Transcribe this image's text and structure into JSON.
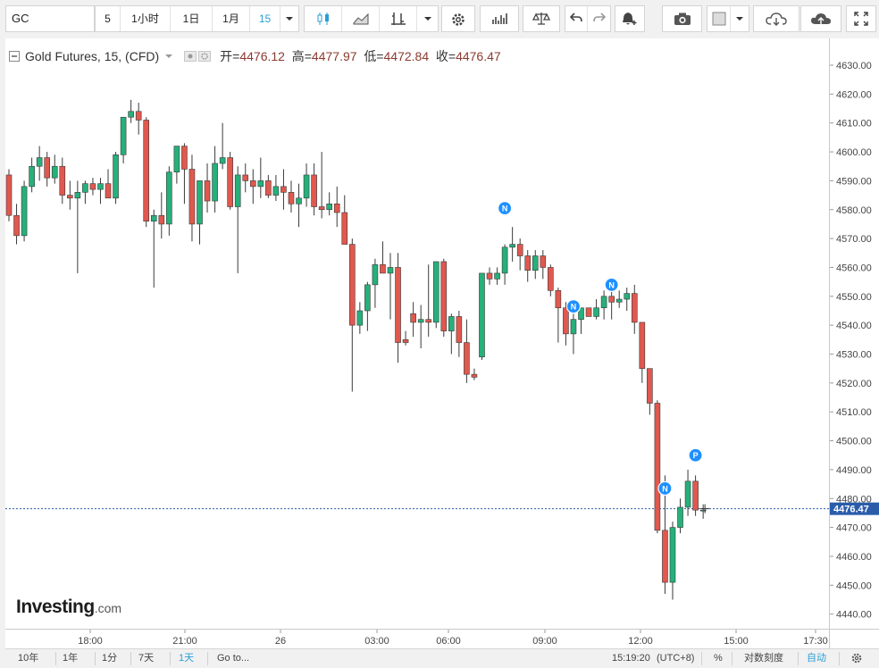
{
  "toolbar": {
    "symbol": "GC",
    "intervals": [
      "5",
      "1小时",
      "1日",
      "1月",
      "15"
    ],
    "active_interval": "15"
  },
  "legend": {
    "title": "Gold Futures, 15, (CFD)",
    "open_label": "开=",
    "open": "4476.12",
    "high_label": "高=",
    "high": "4477.97",
    "low_label": "低=",
    "low": "4472.84",
    "close_label": "收=",
    "close": "4476.47"
  },
  "watermark": {
    "brand": "Investing",
    "suffix": ".com"
  },
  "bottom_bar": {
    "ranges": [
      "10年",
      "1年",
      "1分",
      "7天",
      "1天"
    ],
    "active_range": "1天",
    "goto": "Go to...",
    "clock": "15:19:20",
    "timezone": "(UTC+8)",
    "percent": "%",
    "log_scale": "对数刻度",
    "auto": "自动"
  },
  "colors": {
    "up": "#26b07a",
    "down": "#e0584e",
    "accent": "#2a9fd6",
    "price_line": "#2a5caa",
    "marker": "#1e90ff"
  },
  "chart_data": {
    "type": "candlestick",
    "title": "Gold Futures, 15, (CFD)",
    "ylim": [
      4435,
      4635
    ],
    "y_ticks": [
      4440,
      4450,
      4460,
      4470,
      4480,
      4490,
      4500,
      4510,
      4520,
      4530,
      4540,
      4550,
      4560,
      4570,
      4580,
      4590,
      4600,
      4610,
      4620,
      4630
    ],
    "x_ticks": [
      "18:00",
      "21:00",
      "26",
      "03:00",
      "06:00",
      "09:00",
      "12:00",
      "15:00",
      "17:30"
    ],
    "last_price": "4476.47",
    "candles": [
      [
        4592,
        4594,
        4576,
        4578
      ],
      [
        4578,
        4582,
        4568,
        4571
      ],
      [
        4571,
        4590,
        4569,
        4588
      ],
      [
        4588,
        4598,
        4586,
        4595
      ],
      [
        4595,
        4602,
        4590,
        4598
      ],
      [
        4598,
        4600,
        4588,
        4591
      ],
      [
        4591,
        4599,
        4589,
        4595
      ],
      [
        4595,
        4598,
        4582,
        4585
      ],
      [
        4585,
        4590,
        4580,
        4584
      ],
      [
        4584,
        4590,
        4558,
        4586
      ],
      [
        4586,
        4590,
        4582,
        4589
      ],
      [
        4589,
        4591,
        4585,
        4587
      ],
      [
        4587,
        4591,
        4582,
        4589
      ],
      [
        4589,
        4594,
        4584,
        4584
      ],
      [
        4584,
        4600,
        4582,
        4599
      ],
      [
        4599,
        4610,
        4596,
        4612
      ],
      [
        4612,
        4618,
        4610,
        4614
      ],
      [
        4614,
        4617,
        4606,
        4611
      ],
      [
        4611,
        4612,
        4574,
        4576
      ],
      [
        4576,
        4580,
        4553,
        4578
      ],
      [
        4578,
        4586,
        4570,
        4575
      ],
      [
        4575,
        4595,
        4571,
        4593
      ],
      [
        4593,
        4601,
        4589,
        4602
      ],
      [
        4602,
        4603,
        4582,
        4594
      ],
      [
        4594,
        4599,
        4569,
        4575
      ],
      [
        4575,
        4588,
        4568,
        4590
      ],
      [
        4590,
        4596,
        4579,
        4583
      ],
      [
        4583,
        4602,
        4579,
        4596
      ],
      [
        4596,
        4610,
        4594,
        4598
      ],
      [
        4598,
        4600,
        4580,
        4581
      ],
      [
        4581,
        4595,
        4558,
        4592
      ],
      [
        4592,
        4596,
        4586,
        4590
      ],
      [
        4590,
        4594,
        4582,
        4588
      ],
      [
        4588,
        4598,
        4584,
        4590
      ],
      [
        4590,
        4592,
        4584,
        4585
      ],
      [
        4585,
        4592,
        4583,
        4588
      ],
      [
        4588,
        4594,
        4580,
        4586
      ],
      [
        4586,
        4590,
        4579,
        4582
      ],
      [
        4582,
        4589,
        4574,
        4584
      ],
      [
        4584,
        4596,
        4581,
        4592
      ],
      [
        4592,
        4596,
        4578,
        4581
      ],
      [
        4581,
        4600,
        4577,
        4580
      ],
      [
        4580,
        4586,
        4578,
        4582
      ],
      [
        4582,
        4588,
        4574,
        4579
      ],
      [
        4579,
        4585,
        4568,
        4568
      ],
      [
        4568,
        4570,
        4517,
        4540
      ],
      [
        4540,
        4548,
        4537,
        4545
      ],
      [
        4545,
        4555,
        4538,
        4554
      ],
      [
        4554,
        4563,
        4546,
        4561
      ],
      [
        4561,
        4569,
        4558,
        4558
      ],
      [
        4558,
        4565,
        4542,
        4560
      ],
      [
        4560,
        4565,
        4527,
        4534
      ],
      [
        4535,
        4538,
        4533,
        4534
      ],
      [
        4544,
        4548,
        4536,
        4541
      ],
      [
        4541,
        4547,
        4532,
        4542
      ],
      [
        4542,
        4561,
        4536,
        4541
      ],
      [
        4541,
        4562,
        4539,
        4562
      ],
      [
        4562,
        4563,
        4536,
        4538
      ],
      [
        4538,
        4544,
        4530,
        4543
      ],
      [
        4543,
        4545,
        4529,
        4534
      ],
      [
        4534,
        4542,
        4520,
        4523
      ],
      [
        4523,
        4525,
        4521,
        4522
      ],
      [
        4529,
        4558,
        4528,
        4558
      ],
      [
        4558,
        4560,
        4554,
        4556
      ],
      [
        4556,
        4560,
        4554,
        4558
      ],
      [
        4558,
        4568,
        4554,
        4567
      ],
      [
        4567,
        4574,
        4562,
        4568
      ],
      [
        4568,
        4570,
        4559,
        4564
      ],
      [
        4564,
        4566,
        4555,
        4559
      ],
      [
        4559,
        4566,
        4556,
        4564
      ],
      [
        4564,
        4566,
        4556,
        4560
      ],
      [
        4560,
        4561,
        4550,
        4552
      ],
      [
        4552,
        4553,
        4534,
        4546
      ],
      [
        4546,
        4548,
        4533,
        4537
      ],
      [
        4537,
        4544,
        4530,
        4542
      ],
      [
        4542,
        4546,
        4537,
        4546
      ],
      [
        4546,
        4545,
        4543,
        4543
      ],
      [
        4543,
        4549,
        4542,
        4546
      ],
      [
        4546,
        4552,
        4542,
        4550
      ],
      [
        4550,
        4552,
        4542,
        4548
      ],
      [
        4548,
        4552,
        4546,
        4549
      ],
      [
        4549,
        4553,
        4545,
        4551
      ],
      [
        4551,
        4554,
        4537,
        4541
      ],
      [
        4541,
        4536,
        4520,
        4525
      ],
      [
        4525,
        4523,
        4509,
        4513
      ],
      [
        4513,
        4514,
        4468,
        4469
      ],
      [
        4469,
        4488,
        4447,
        4451
      ],
      [
        4451,
        4472,
        4445,
        4470
      ],
      [
        4470,
        4480,
        4468,
        4477
      ],
      [
        4477,
        4490,
        4474,
        4486
      ],
      [
        4486,
        4488,
        4474,
        4476
      ],
      [
        4476,
        4478,
        4473,
        4476
      ]
    ],
    "markers": [
      {
        "label": "N",
        "index": 65,
        "price": 4580.5
      },
      {
        "label": "N",
        "index": 74,
        "price": 4546.5
      },
      {
        "label": "N",
        "index": 79,
        "price": 4554
      },
      {
        "label": "N",
        "index": 86,
        "price": 4483.5
      },
      {
        "label": "P",
        "index": 90,
        "price": 4495
      }
    ]
  }
}
